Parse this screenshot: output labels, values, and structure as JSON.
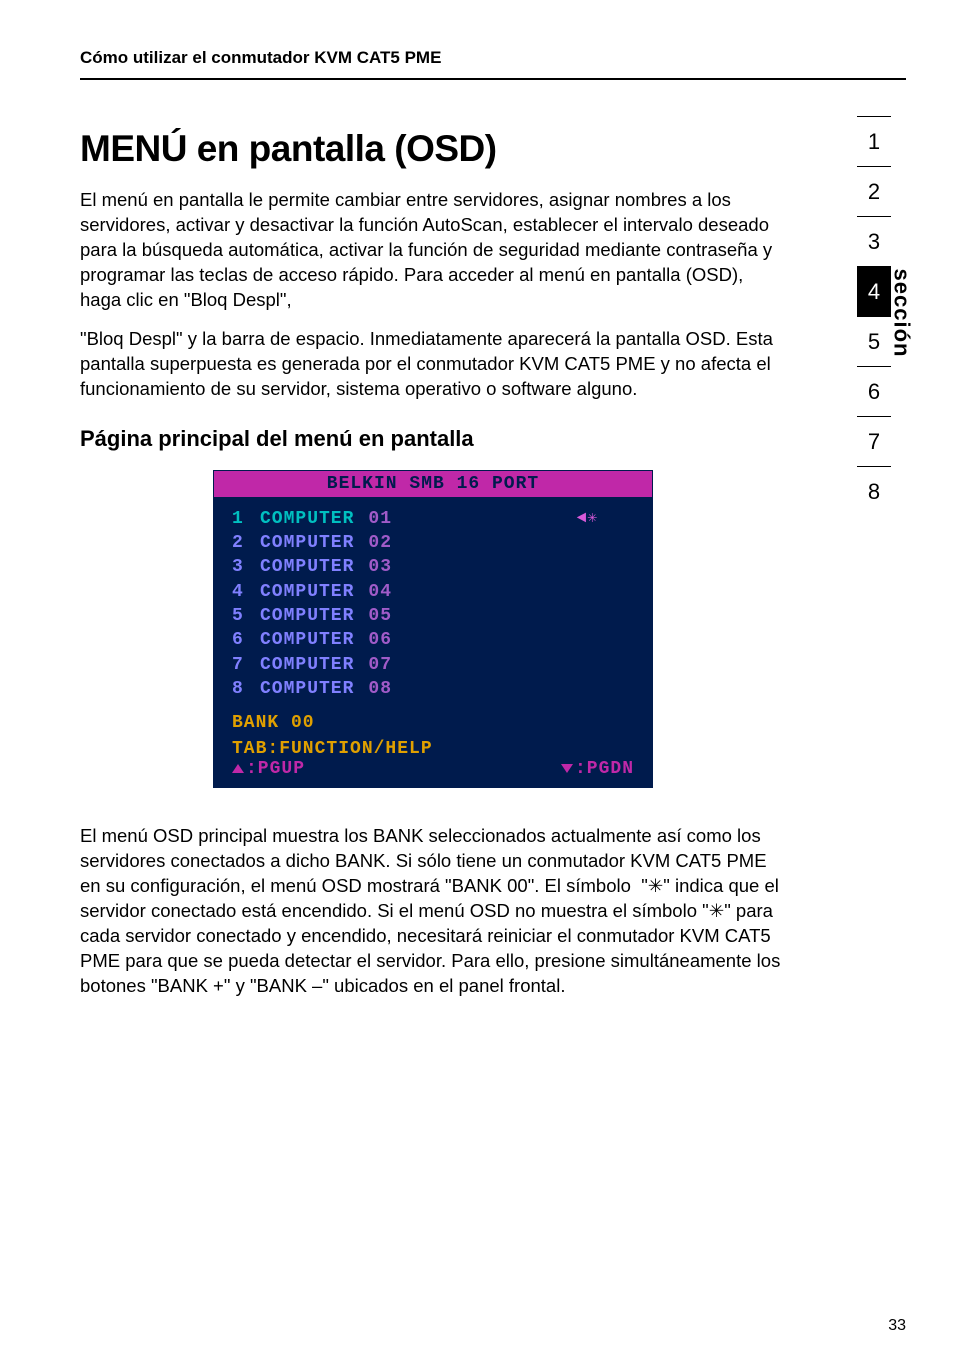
{
  "header": {
    "breadcrumb": "Cómo utilizar el conmutador KVM CAT5 PME"
  },
  "title": "MENÚ en pantalla (OSD)",
  "intro": "El menú en pantalla le permite cambiar entre servidores, asignar nombres a los servidores, activar y desactivar la función AutoScan, establecer el intervalo deseado para la búsqueda automática, activar la función de seguridad mediante contraseña y programar las teclas de acceso rápido. Para acceder al menú en pantalla (OSD), haga clic en \"Bloq Despl\",",
  "intro2": "\"Bloq Despl\" y la barra de espacio. Inmediatamente aparecerá la pantalla OSD. Esta pantalla superpuesta es generada por el conmutador KVM CAT5 PME y no afecta el funcionamiento de su servidor, sistema operativo o software alguno.",
  "subhead": "Página principal del menú en pantalla",
  "osd": {
    "title": "BELKIN SMB 16 PORT",
    "rows": [
      {
        "idx": "1",
        "name": "COMPUTER",
        "num": "01",
        "selected": true,
        "mark": "◄✳"
      },
      {
        "idx": "2",
        "name": "COMPUTER",
        "num": "02",
        "selected": false,
        "mark": ""
      },
      {
        "idx": "3",
        "name": "COMPUTER",
        "num": "03",
        "selected": false,
        "mark": ""
      },
      {
        "idx": "4",
        "name": "COMPUTER",
        "num": "04",
        "selected": false,
        "mark": ""
      },
      {
        "idx": "5",
        "name": "COMPUTER",
        "num": "05",
        "selected": false,
        "mark": ""
      },
      {
        "idx": "6",
        "name": "COMPUTER",
        "num": "06",
        "selected": false,
        "mark": ""
      },
      {
        "idx": "7",
        "name": "COMPUTER",
        "num": "07",
        "selected": false,
        "mark": ""
      },
      {
        "idx": "8",
        "name": "COMPUTER",
        "num": "08",
        "selected": false,
        "mark": ""
      }
    ],
    "bank": "BANK 00",
    "tab": "TAB:FUNCTION/HELP",
    "pgup": ":PGUP",
    "pgdn": ":PGDN"
  },
  "body2a": "El menú OSD principal muestra los BANK seleccionados actualmente así como los servidores conectados a dicho BANK. Si sólo tiene un conmutador KVM CAT5 PME en su configuración, el menú OSD mostrará \"BANK 00\". El símbolo  \"",
  "body2b": "✳",
  "body2c": "\" indica que el servidor conectado está encendido. Si el menú OSD no muestra el símbolo \"",
  "body2d": "✳",
  "body2e": "\" para cada servidor conectado y encendido, necesitará reiniciar el conmutador KVM CAT5 PME para que se pueda detectar el servidor. Para ello, presione simultáneamente los botones  \"BANK +\" y \"BANK –\" ubicados en el panel frontal.",
  "rail": {
    "label": "sección",
    "items": [
      {
        "n": "1",
        "active": false
      },
      {
        "n": "2",
        "active": false
      },
      {
        "n": "3",
        "active": false
      },
      {
        "n": "4",
        "active": true
      },
      {
        "n": "5",
        "active": false
      },
      {
        "n": "6",
        "active": false
      },
      {
        "n": "7",
        "active": false
      },
      {
        "n": "8",
        "active": false
      }
    ]
  },
  "pagenum": "33"
}
